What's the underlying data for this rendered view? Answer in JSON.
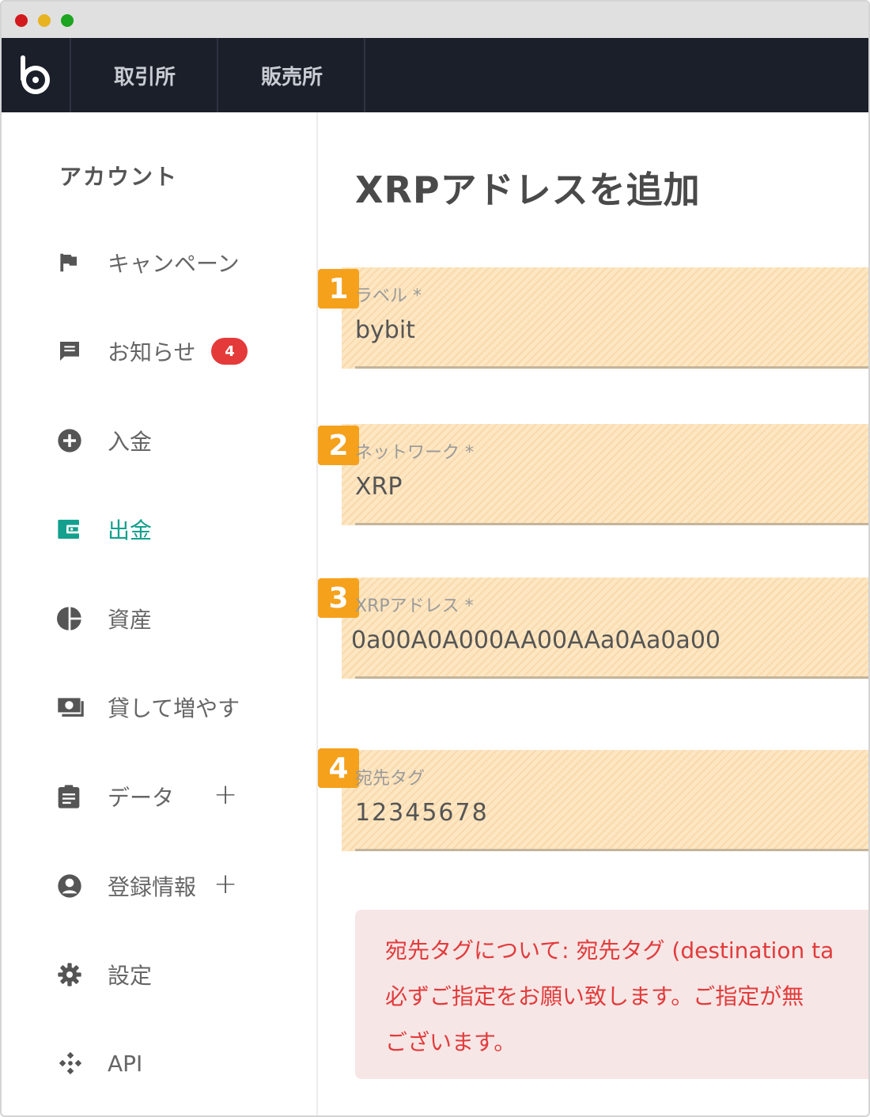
{
  "navbar": {
    "logo_alt": "b",
    "tabs": [
      {
        "label": "取引所"
      },
      {
        "label": "販売所"
      }
    ]
  },
  "sidebar": {
    "section_title": "アカウント",
    "items": [
      {
        "label": "キャンペーン",
        "icon": "flag-icon"
      },
      {
        "label": "お知らせ",
        "icon": "message-icon",
        "badge": "4"
      },
      {
        "label": "入金",
        "icon": "plus-circle-icon"
      },
      {
        "label": "出金",
        "icon": "wallet-icon",
        "active": true
      },
      {
        "label": "資産",
        "icon": "pie-chart-icon"
      },
      {
        "label": "貸して増やす",
        "icon": "money-icon"
      },
      {
        "label": "データ",
        "icon": "clipboard-icon",
        "expandable": true
      },
      {
        "label": "登録情報",
        "icon": "account-circle-icon",
        "expandable": true
      },
      {
        "label": "設定",
        "icon": "gear-icon"
      },
      {
        "label": "API",
        "icon": "api-icon"
      }
    ],
    "expand_symbol": "+"
  },
  "main": {
    "title": "XRPアドレスを追加",
    "fields": [
      {
        "step": "1",
        "label": "ラベル *",
        "value": "bybit"
      },
      {
        "step": "2",
        "label": "ネットワーク *",
        "value": "XRP"
      },
      {
        "step": "3",
        "label": "XRPアドレス *",
        "value": "0a00A0A000AA00AAa0Aa0a00"
      },
      {
        "step": "4",
        "label": "宛先タグ",
        "value": "12345678"
      }
    ],
    "notice": {
      "line1": "宛先タグについて: 宛先タグ (destination ta",
      "line2": "必ずご指定をお願い致します。ご指定が無",
      "line3": "ございます。"
    }
  },
  "colors": {
    "accent": "#14a08e",
    "navbar_bg": "#1b1f2a",
    "step_badge": "#f5a11b",
    "badge_red": "#e53a3a",
    "notice_text": "#e23b3b",
    "notice_bg": "#f6e6e6"
  }
}
